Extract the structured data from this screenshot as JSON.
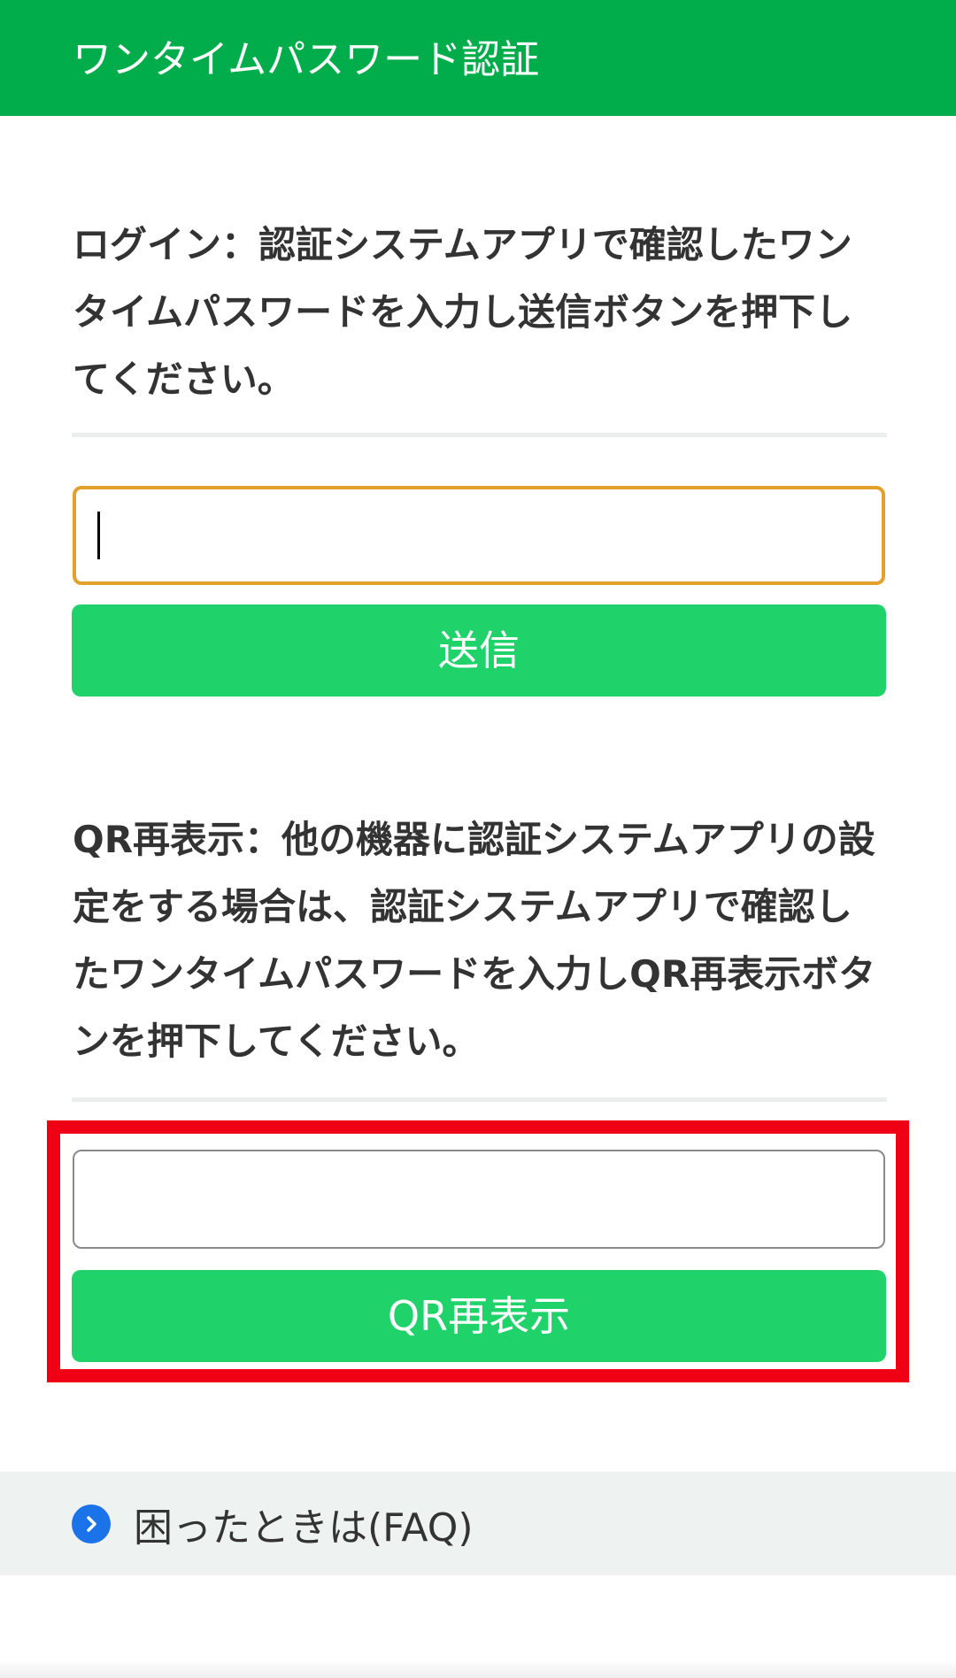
{
  "header": {
    "title": "ワンタイムパスワード認証"
  },
  "login_section": {
    "instruction": "ログイン：認証システムアプリで確認したワンタイムパスワードを入力し送信ボタンを押下してください。",
    "input_value": "",
    "submit_label": "送信"
  },
  "qr_section": {
    "instruction": "QR再表示：他の機器に認証システムアプリの設定をする場合は、認証システムアプリで確認したワンタイムパスワードを入力しQR再表示ボタンを押下してください。",
    "input_value": "",
    "submit_label": "QR再表示"
  },
  "faq": {
    "label": "困ったときは(FAQ)",
    "icon": "chevron-right-circle-icon"
  },
  "colors": {
    "header_bg": "#00ad4a",
    "button_bg": "#1fd36a",
    "focus_border": "#e3a02c",
    "highlight_border": "#f00015",
    "faq_bg": "#eef2f0",
    "faq_icon": "#1a73e8"
  }
}
